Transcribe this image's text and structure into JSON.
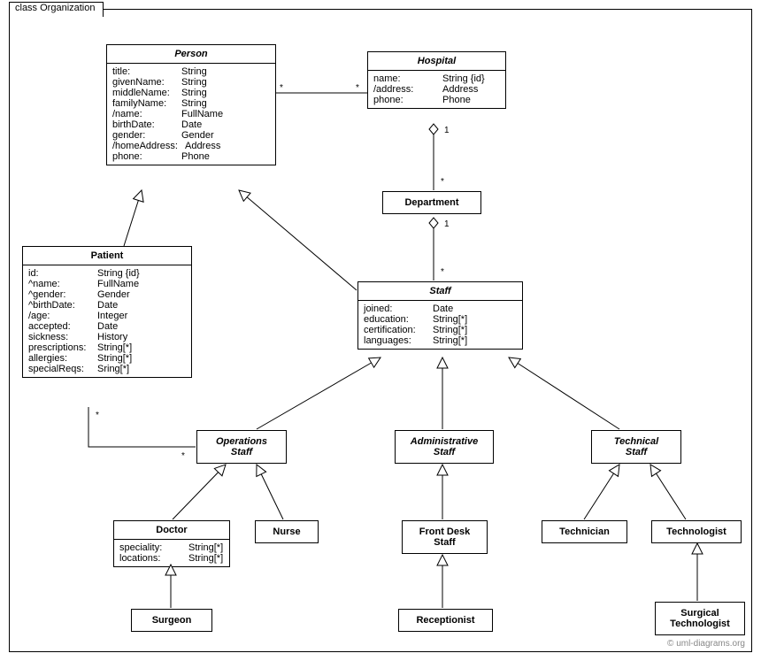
{
  "diagram_title": "class Organization",
  "watermark": "© uml-diagrams.org",
  "classes": {
    "person": {
      "name": "Person",
      "attrs": [
        {
          "n": "title:",
          "t": "String"
        },
        {
          "n": "givenName:",
          "t": "String"
        },
        {
          "n": "middleName:",
          "t": "String"
        },
        {
          "n": "familyName:",
          "t": "String"
        },
        {
          "n": "/name:",
          "t": "FullName"
        },
        {
          "n": "birthDate:",
          "t": "Date"
        },
        {
          "n": "gender:",
          "t": "Gender"
        },
        {
          "n": "/homeAddress:",
          "t": "Address"
        },
        {
          "n": "phone:",
          "t": "Phone"
        }
      ]
    },
    "hospital": {
      "name": "Hospital",
      "attrs": [
        {
          "n": "name:",
          "t": "String {id}"
        },
        {
          "n": "/address:",
          "t": "Address"
        },
        {
          "n": "phone:",
          "t": "Phone"
        }
      ]
    },
    "department": {
      "name": "Department"
    },
    "patient": {
      "name": "Patient",
      "attrs": [
        {
          "n": "id:",
          "t": "String {id}"
        },
        {
          "n": "^name:",
          "t": "FullName"
        },
        {
          "n": "^gender:",
          "t": "Gender"
        },
        {
          "n": "^birthDate:",
          "t": "Date"
        },
        {
          "n": "/age:",
          "t": "Integer"
        },
        {
          "n": "accepted:",
          "t": "Date"
        },
        {
          "n": "sickness:",
          "t": "History"
        },
        {
          "n": "prescriptions:",
          "t": "String[*]"
        },
        {
          "n": "allergies:",
          "t": "String[*]"
        },
        {
          "n": "specialReqs:",
          "t": "Sring[*]"
        }
      ]
    },
    "staff": {
      "name": "Staff",
      "attrs": [
        {
          "n": "joined:",
          "t": "Date"
        },
        {
          "n": "education:",
          "t": "String[*]"
        },
        {
          "n": "certification:",
          "t": "String[*]"
        },
        {
          "n": "languages:",
          "t": "String[*]"
        }
      ]
    },
    "ops": {
      "name": "Operations",
      "sub": "Staff"
    },
    "admin": {
      "name": "Administrative",
      "sub": "Staff"
    },
    "tech": {
      "name": "Technical",
      "sub": "Staff"
    },
    "doctor": {
      "name": "Doctor",
      "attrs": [
        {
          "n": "speciality:",
          "t": "String[*]"
        },
        {
          "n": "locations:",
          "t": "String[*]"
        }
      ]
    },
    "nurse": {
      "name": "Nurse"
    },
    "frontdesk": {
      "name": "Front Desk",
      "sub": "Staff"
    },
    "technician": {
      "name": "Technician"
    },
    "technologist": {
      "name": "Technologist"
    },
    "surgeon": {
      "name": "Surgeon"
    },
    "receptionist": {
      "name": "Receptionist"
    },
    "surgtech": {
      "name": "Surgical",
      "sub": "Technologist"
    }
  },
  "mult": {
    "h_star_l": "*",
    "h_star_r": "*",
    "hd_one": "1",
    "hd_star": "*",
    "ds_one": "1",
    "ds_star": "*",
    "po_star_l": "*",
    "po_star_r": "*"
  }
}
